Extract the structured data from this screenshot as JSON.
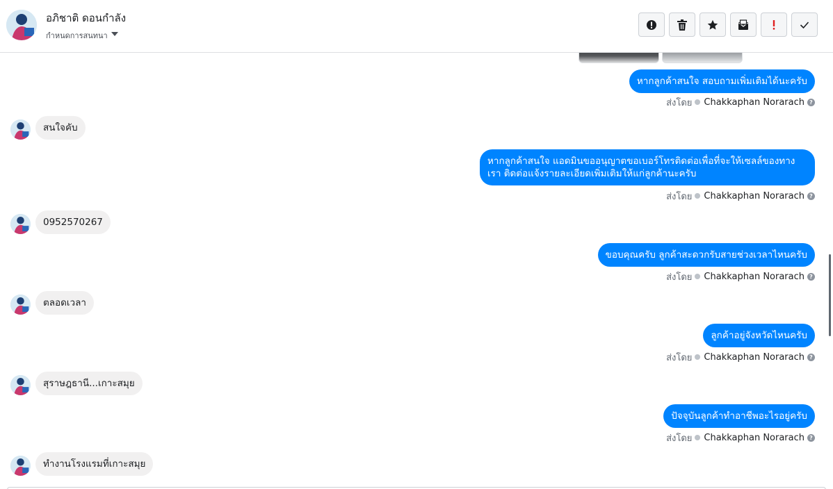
{
  "header": {
    "contact_name": "อภิชาติ ดอนกำลัง",
    "assign_label": "กำหนดการสนทนา",
    "actions": [
      {
        "icon": "alert-circle-icon",
        "label": "mark-spam"
      },
      {
        "icon": "trash-icon",
        "label": "delete"
      },
      {
        "icon": "star-icon",
        "label": "star"
      },
      {
        "icon": "mark-unread-icon",
        "label": "mark-unread"
      },
      {
        "icon": "exclamation-icon",
        "label": "follow-up"
      },
      {
        "icon": "check-icon",
        "label": "done"
      }
    ]
  },
  "sent_by_label": "ส่งโดย",
  "messages": [
    {
      "direction": "out",
      "text": "หากลูกค้าสนใจ สอบถามเพิ่มเติมได้นะครับ",
      "sender": "Chakkaphan Norarach"
    },
    {
      "direction": "in",
      "text": "สนใจคับ"
    },
    {
      "direction": "out",
      "text": "หากลูกค้าสนใจ แอดมินขออนุญาตขอเบอร์โทรติดต่อเพื่อที่จะให้เซลล์ของทางเรา ติดต่อแจ้งรายละเอียดเพิ่มเติมให้แก่ลูกค้านะครับ",
      "sender": "Chakkaphan Norarach"
    },
    {
      "direction": "in",
      "text": "0952570267"
    },
    {
      "direction": "out",
      "text": "ขอบคุณครับ ลูกค้าสะดวกรับสายช่วงเวลาไหนครับ",
      "sender": "Chakkaphan Norarach"
    },
    {
      "direction": "in",
      "text": "ตลอดเวลา"
    },
    {
      "direction": "out",
      "text": "ลูกค้าอยู่จังหวัดไหนครับ",
      "sender": "Chakkaphan Norarach"
    },
    {
      "direction": "in",
      "text": "สุราษฎธานี...เกาะสมุย"
    },
    {
      "direction": "out",
      "text": "ปัจจุบันลูกค้าทำอาชีพอะไรอยู่ครับ",
      "sender": "Chakkaphan Norarach"
    },
    {
      "direction": "in",
      "text": "ทำงานโรงแรมที่เกาะสมุย"
    }
  ],
  "colors": {
    "outgoing_bubble": "#0084ff",
    "incoming_bubble": "#f1f0f0",
    "header_border": "#dddfe2"
  }
}
